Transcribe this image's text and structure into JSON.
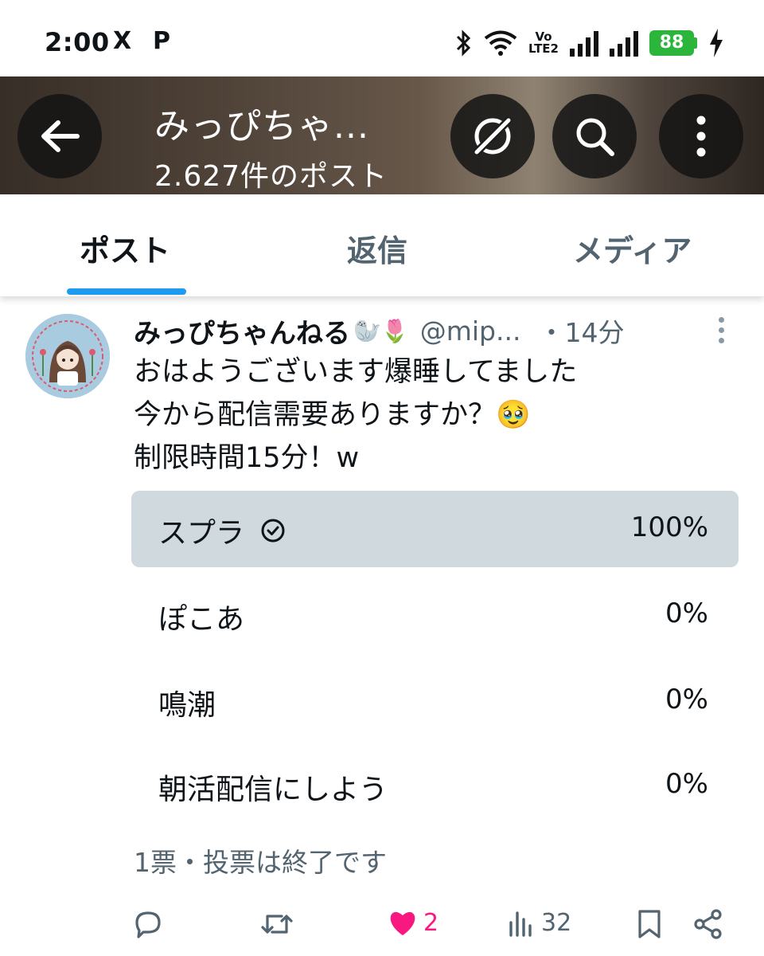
{
  "status_bar": {
    "time": "2:00",
    "app_icons": [
      "X",
      "P"
    ],
    "battery": "88",
    "network_label": "Vo LTE2"
  },
  "header": {
    "title": "みっぴちゃ...",
    "post_count": "2.627件のポスト"
  },
  "tabs": [
    {
      "label": "ポスト",
      "active": true
    },
    {
      "label": "返信",
      "active": false
    },
    {
      "label": "メディア",
      "active": false
    }
  ],
  "post": {
    "author_name": "みっぴちゃんねる",
    "author_emojis": "🦭🌷",
    "handle": "@mip...",
    "time": "・14分",
    "text_lines": [
      "おはようございます爆睡してました",
      "今から配信需要ありますか？🥹",
      "制限時間15分！w"
    ]
  },
  "poll": {
    "options": [
      {
        "label": "スプラ",
        "percent": "100%",
        "fraction": 1.0,
        "winner": true
      },
      {
        "label": "ぽこあ",
        "percent": "0%",
        "fraction": 0.0,
        "winner": false
      },
      {
        "label": "鳴潮",
        "percent": "0%",
        "fraction": 0.0,
        "winner": false
      },
      {
        "label": "朝活配信にしよう",
        "percent": "0%",
        "fraction": 0.0,
        "winner": false
      }
    ],
    "meta": "1票・投票は終了です"
  },
  "actions": {
    "likes": "2",
    "views": "32"
  },
  "colors": {
    "accent": "#1d9bf0",
    "like": "#f91880",
    "secondary_text": "#536471",
    "poll_fill": "#cfd9de",
    "battery": "#2bb63b"
  }
}
